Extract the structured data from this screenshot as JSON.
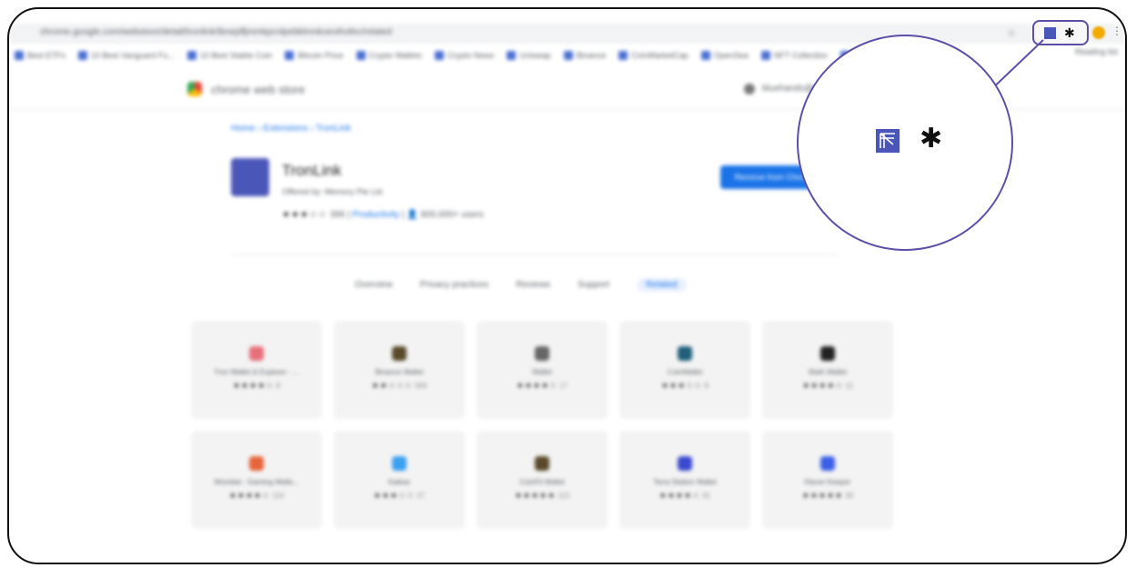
{
  "browser": {
    "url": "chrome.google.com/webstore/detail/tronlink/ibnejdfjmmkpcnlpebklmnkoeoihofec/related",
    "bookmarks": [
      "Best ETFs",
      "10 Best Vanguard Fu...",
      "10 Best Stable Coin",
      "Bitcoin Price",
      "Crypto Wallets",
      "Crypto News",
      "Uniswap",
      "Binance",
      "CoinMarketCap",
      "OpenSea",
      "NFT Collection",
      "Ethereum"
    ],
    "bookmarks_right": "Reading list",
    "extensions_bar": {
      "icons": [
        "tronlink-icon",
        "puzzle-icon"
      ]
    }
  },
  "store": {
    "name": "chrome web store",
    "account": "bluehands@gmail.com"
  },
  "breadcrumb": "Home › Extensions › TronLink",
  "extension": {
    "title": "TronLink",
    "offered_by": "Offered by: Memory Pte Ltd",
    "stars": "★★★☆☆",
    "rating_count": "396",
    "category": "Productivity",
    "users": "800,000+ users",
    "remove_label": "Remove from Chrome"
  },
  "tabs": [
    {
      "label": "Overview",
      "active": false
    },
    {
      "label": "Privacy practices",
      "active": false
    },
    {
      "label": "Reviews",
      "active": false
    },
    {
      "label": "Support",
      "active": false
    },
    {
      "label": "Related",
      "active": true
    }
  ],
  "related": [
    {
      "name": "Tron Wallet & Explorer - ...",
      "stars": "★★★★☆",
      "count": "8",
      "color": "#e86f7a"
    },
    {
      "name": "Binance Wallet",
      "stars": "★★☆☆☆",
      "count": "594",
      "color": "#5a4a2a"
    },
    {
      "name": "Wallet",
      "stars": "★★★★☆",
      "count": "17",
      "color": "#666666"
    },
    {
      "name": "CoinWallet",
      "stars": "★★★☆☆",
      "count": "8",
      "color": "#1f5f7a"
    },
    {
      "name": "Math Wallet",
      "stars": "★★★★☆",
      "count": "11",
      "color": "#222222"
    },
    {
      "name": "Wombat - Gaming Walle...",
      "stars": "★★★★☆",
      "count": "110",
      "color": "#e8643a"
    },
    {
      "name": "Kaikas",
      "stars": "★★★☆☆",
      "count": "27",
      "color": "#3aa0f0"
    },
    {
      "name": "CoinFit Wallet",
      "stars": "★★★★★",
      "count": "112",
      "color": "#5a4a2a"
    },
    {
      "name": "Terra Station Wallet",
      "stars": "★★★★☆",
      "count": "91",
      "color": "#3a4acf"
    },
    {
      "name": "Klever Keeper",
      "stars": "★★★★★",
      "count": "30",
      "color": "#3a5fe8"
    }
  ],
  "colors": {
    "accent": "#1a73e8",
    "tronlink": "#4b57b8",
    "highlight": "#5b4fa8"
  }
}
